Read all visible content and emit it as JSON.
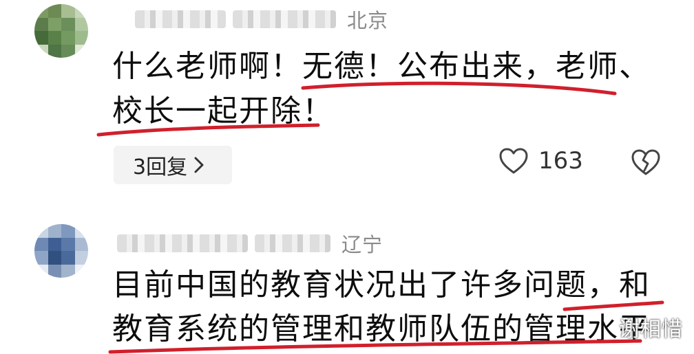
{
  "comments": [
    {
      "location": "北京",
      "line1": "什么老师啊！无德！公布出来，老师、",
      "line2": "校长一起开除！",
      "reply_label": "3回复",
      "like_count": "163"
    },
    {
      "location": "辽宁",
      "line1": "目前中国的教育状况出了许多问题，和",
      "line2": "教育系统的管理和教师队伍的管理水平"
    }
  ],
  "watermark": "谢相惜",
  "icons": {
    "like": "heart-icon",
    "dislike": "broken-heart-icon",
    "chevron": "chevron-right-icon"
  },
  "colors": {
    "underline": "#d0202c",
    "reply_bg": "#f3f3f3",
    "location": "#8a8a8a"
  }
}
